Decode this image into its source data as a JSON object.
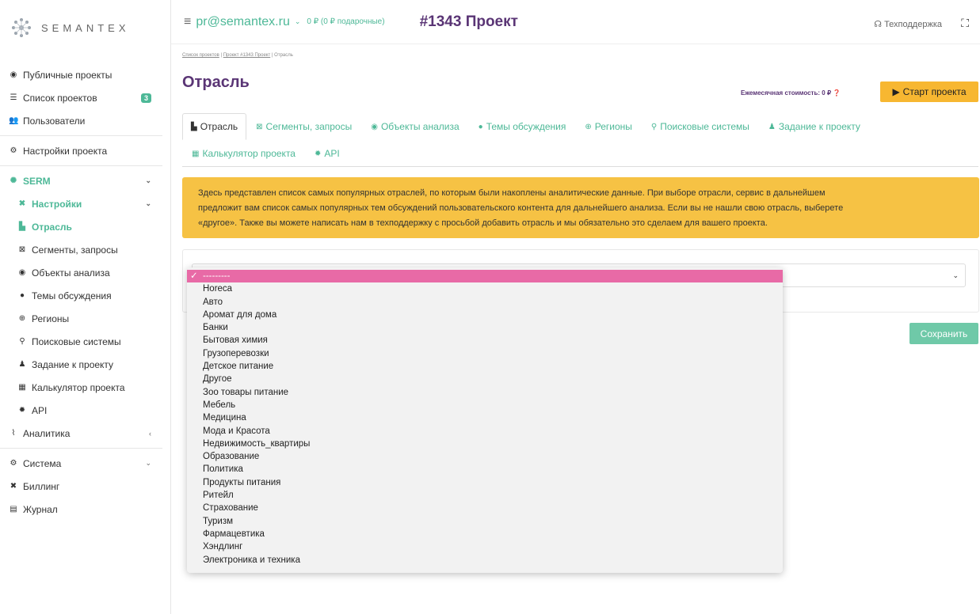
{
  "brand": {
    "name": "SEMANTEX"
  },
  "sidebar": {
    "items": [
      {
        "icon": "eye-icon",
        "label": "Публичные проекты"
      },
      {
        "icon": "list-icon",
        "label": "Список проектов",
        "badge": "3"
      },
      {
        "icon": "users-icon",
        "label": "Пользователи"
      },
      {
        "icon": "cogs-icon",
        "label": "Настройки проекта"
      }
    ],
    "serm": {
      "label": "SERM"
    },
    "settings": {
      "label": "Настройки"
    },
    "sub_items": [
      {
        "icon": "industry-icon",
        "label": "Отрасль"
      },
      {
        "icon": "segments-icon",
        "label": "Сегменты, запросы"
      },
      {
        "icon": "target-icon",
        "label": "Объекты анализа"
      },
      {
        "icon": "comments-icon",
        "label": "Темы обсуждения"
      },
      {
        "icon": "globe-icon",
        "label": "Регионы"
      },
      {
        "icon": "search-icon",
        "label": "Поисковые системы"
      },
      {
        "icon": "user-edit-icon",
        "label": "Задание к проекту"
      },
      {
        "icon": "calculator-icon",
        "label": "Калькулятор проекта"
      },
      {
        "icon": "gear-icon",
        "label": "API"
      }
    ],
    "analytics": {
      "label": "Аналитика"
    },
    "system": {
      "label": "Система"
    },
    "billing": {
      "label": "Биллинг"
    },
    "journal": {
      "label": "Журнал"
    }
  },
  "topbar": {
    "email": "pr@semantex.ru",
    "balance": "0 ₽ (0 ₽ подарочные)",
    "project_title": "#1343 Проект",
    "support": "Техподдержка"
  },
  "breadcrumb": {
    "items": [
      "Список проектов",
      "Проект #1343 Проект",
      "Отрасль"
    ]
  },
  "page": {
    "title": "Отрасль",
    "cost": "Ежемесячная стоимость: 0 ₽",
    "start_button": "Старт проекта",
    "save_button": "Сохранить"
  },
  "tabs": [
    {
      "icon": "industry-icon",
      "label": "Отрасль"
    },
    {
      "icon": "segments-icon",
      "label": "Сегменты, запросы"
    },
    {
      "icon": "target-icon",
      "label": "Объекты анализа"
    },
    {
      "icon": "comments-icon",
      "label": "Темы обсуждения"
    },
    {
      "icon": "globe-icon",
      "label": "Регионы"
    },
    {
      "icon": "search-icon",
      "label": "Поисковые системы"
    },
    {
      "icon": "user-edit-icon",
      "label": "Задание к проекту"
    },
    {
      "icon": "calculator-icon",
      "label": "Калькулятор проекта"
    },
    {
      "icon": "gear-icon",
      "label": "API"
    }
  ],
  "info": {
    "line1": "Здесь представлен список самых популярных отраслей, по которым были накоплены аналитические данные. При выборе отрасли, сервис в дальнейшем",
    "line2": "предложит вам список самых популярных тем обсуждений пользовательского контента для дальнейшего анализа. Если вы не нашли свою отрасль, выберете",
    "line3": "«другое». Также вы можете написать нам в техподдержку с просьбой добавить отрасль и мы обязательно это сделаем для вашего проекта."
  },
  "dropdown": {
    "options": [
      "---------",
      "Horeca",
      "Авто",
      "Аромат для дома",
      "Банки",
      "Бытовая химия",
      "Грузоперевозки",
      "Детское питание",
      "Другое",
      "Зоо товары питание",
      "Мебель",
      "Медицина",
      "Мода и Красота",
      "Недвижимость_квартиры",
      "Образование",
      "Политика",
      "Продукты питания",
      "Ритейл",
      "Страхование",
      "Туризм",
      "Фармацевтика",
      "Хэндлинг",
      "Электроника и техника"
    ]
  },
  "colors": {
    "accent": "#4db897",
    "brand_purple": "#5a3575",
    "warning": "#f6c244",
    "selected_option": "#e86aa6"
  }
}
